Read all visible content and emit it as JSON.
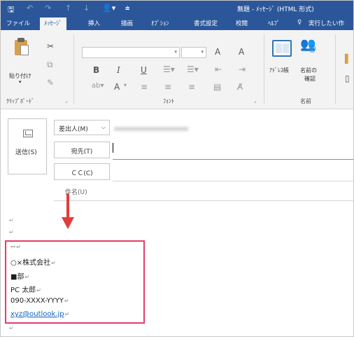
{
  "window": {
    "title": "無題 - ﾒｯｾｰｼﾞ (HTML 形式)"
  },
  "qat": {
    "save_icon": "save-icon",
    "undo_icon": "undo-icon",
    "redo_icon": "redo-icon",
    "up_icon": "up-arrow-icon",
    "down_icon": "down-arrow-icon",
    "account_icon": "account-icon",
    "more_icon": "customize-qat-icon"
  },
  "tabs": [
    "ファイル",
    "ﾒｯｾｰｼﾞ",
    "挿入",
    "描画",
    "ｵﾌﾟｼｮﾝ",
    "書式設定",
    "校閲",
    "ﾍﾙﾌﾟ",
    "実行したい作"
  ],
  "tell_me_icon": "lightbulb-icon",
  "ribbon": {
    "clipboard": {
      "paste": "貼り付け",
      "paste_dropdown": "▾",
      "group": "ｸﾘｯﾌﾟﾎﾞｰﾄﾞ"
    },
    "font": {
      "group": "ﾌｫﾝﾄ",
      "bold": "B",
      "italic": "I",
      "underline": "U",
      "grow": "A",
      "shrink": "A",
      "font_color": "A"
    },
    "names": {
      "address_book": "ｱﾄﾞﾚｽ帳",
      "check_names_1": "名前の",
      "check_names_2": "確認",
      "group": "名前"
    }
  },
  "header": {
    "send": "送信(S)",
    "from": "差出人(M)",
    "to": "宛先(T)",
    "cc": "ＣＣ(C)",
    "subject": "件名(U)"
  },
  "body": {
    "paragraph_mark": "↵",
    "signature": [
      "--",
      "○×株式会社",
      "■部",
      "PC 太郎",
      "090-XXXX-YYYY",
      "xyz@outlook.jp"
    ]
  },
  "colors": {
    "accent": "#2b579a",
    "highlight_box": "#e33c6b",
    "arrow": "#e23d3d",
    "link": "#0563c1"
  }
}
